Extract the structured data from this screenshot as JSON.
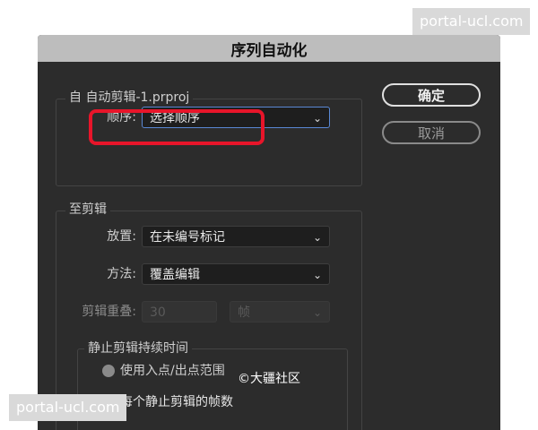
{
  "dialog": {
    "title": "序列自动化",
    "from_group_label": "自 自动剪辑-1.prproj",
    "ordering": {
      "label": "顺序:",
      "value": "选择顺序"
    },
    "to_group_label": "至剪辑",
    "placement": {
      "label": "放置:",
      "value": "在未编号标记"
    },
    "method": {
      "label": "方法:",
      "value": "覆盖编辑"
    },
    "overlap": {
      "label": "剪辑重叠:",
      "value": "30",
      "unit": "帧"
    },
    "still_group_label": "静止剪辑持续时间",
    "radio_in_out": "使用入点/出点范围",
    "radio_frames": "每个静止剪辑的帧数",
    "ok_label": "确定",
    "cancel_label": "取消"
  },
  "watermarks": {
    "top": "portal-ucl.com",
    "bottom": "portal-ucl.com",
    "credit": "©大疆社区"
  },
  "colors": {
    "highlight": "#e8152a",
    "focus_border": "#5a88d4",
    "dialog_bg": "#2c2c2c",
    "title_bg": "#bdbdbd"
  }
}
